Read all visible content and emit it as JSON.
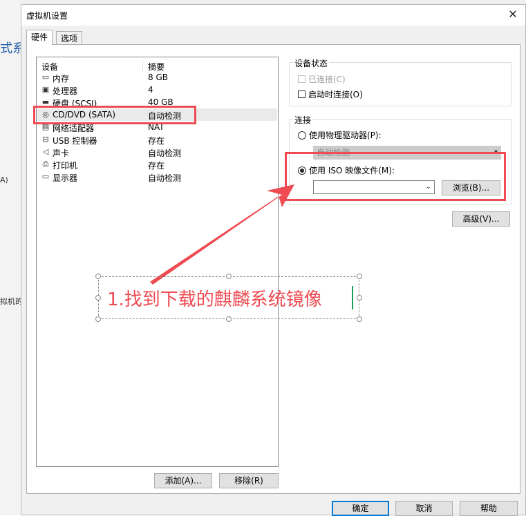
{
  "background_app": {
    "title_fragment": "式系",
    "labels": [
      "A)",
      "拟机的"
    ]
  },
  "dialog": {
    "title": "虚拟机设置",
    "tabs": [
      {
        "label": "硬件",
        "active": true
      },
      {
        "label": "选项",
        "active": false
      }
    ],
    "device_list": {
      "header_device": "设备",
      "header_summary": "摘要",
      "rows": [
        {
          "icon": "memory-icon",
          "device": "内存",
          "summary": "8 GB"
        },
        {
          "icon": "cpu-icon",
          "device": "处理器",
          "summary": "4"
        },
        {
          "icon": "disk-icon",
          "device": "硬盘 (SCSI)",
          "summary": "40 GB"
        },
        {
          "icon": "cd-icon",
          "device": "CD/DVD (SATA)",
          "summary": "自动检测",
          "selected": true
        },
        {
          "icon": "network-icon",
          "device": "网络适配器",
          "summary": "NAT"
        },
        {
          "icon": "usb-icon",
          "device": "USB 控制器",
          "summary": "存在"
        },
        {
          "icon": "speaker-icon",
          "device": "声卡",
          "summary": "自动检测"
        },
        {
          "icon": "printer-icon",
          "device": "打印机",
          "summary": "存在"
        },
        {
          "icon": "monitor-icon",
          "device": "显示器",
          "summary": "自动检测"
        }
      ]
    },
    "add_button": "添加(A)...",
    "remove_button": "移除(R)",
    "device_status": {
      "label": "设备状态",
      "connected": "已连接(C)",
      "connect_at_power_on": "启动时连接(O)"
    },
    "connection": {
      "label": "连接",
      "physical_drive": "使用物理驱动器(P):",
      "physical_drive_value": "自动检测",
      "iso_image": "使用 ISO 映像文件(M):",
      "iso_path": "",
      "browse_button": "浏览(B)...",
      "selected_option": "iso_image"
    },
    "advanced_button": "高级(V)...",
    "ok_button": "确定",
    "cancel_button": "取消",
    "help_button": "帮助"
  },
  "annotation": {
    "text": "1.找到下载的麒麟系统镜像",
    "color": "#ee4b52"
  }
}
